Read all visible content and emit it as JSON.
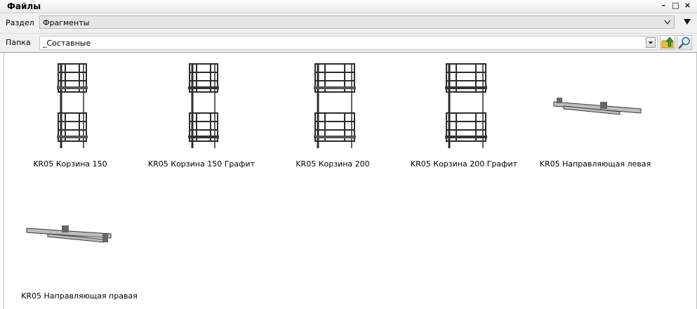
{
  "window": {
    "title": "Файлы",
    "minimize_glyph": "–",
    "restore_glyph": "□",
    "close_glyph": "×"
  },
  "section_row": {
    "label": "Раздел",
    "value": "Фрагменты"
  },
  "folder_row": {
    "label": "Папка",
    "value": "_Составные"
  },
  "icons": {
    "up_folder": "up-folder-icon",
    "search": "magnifier-icon",
    "dropdown": "chevron-down-icon"
  },
  "files": [
    {
      "name": "KR05 Корзина 150",
      "kind": "basket"
    },
    {
      "name": "KR05 Корзина 150 Графит",
      "kind": "basket"
    },
    {
      "name": "KR05 Корзина 200",
      "kind": "basket"
    },
    {
      "name": "KR05 Корзина 200 Графит",
      "kind": "basket"
    },
    {
      "name": "KR05 Направляющая левая",
      "kind": "rail"
    },
    {
      "name": "KR05 Направляющая правая",
      "kind": "rail"
    }
  ],
  "colors": {
    "accent_green": "#3a9a2a",
    "accent_yellow": "#f2c230",
    "metal": "#3a3a3a"
  }
}
